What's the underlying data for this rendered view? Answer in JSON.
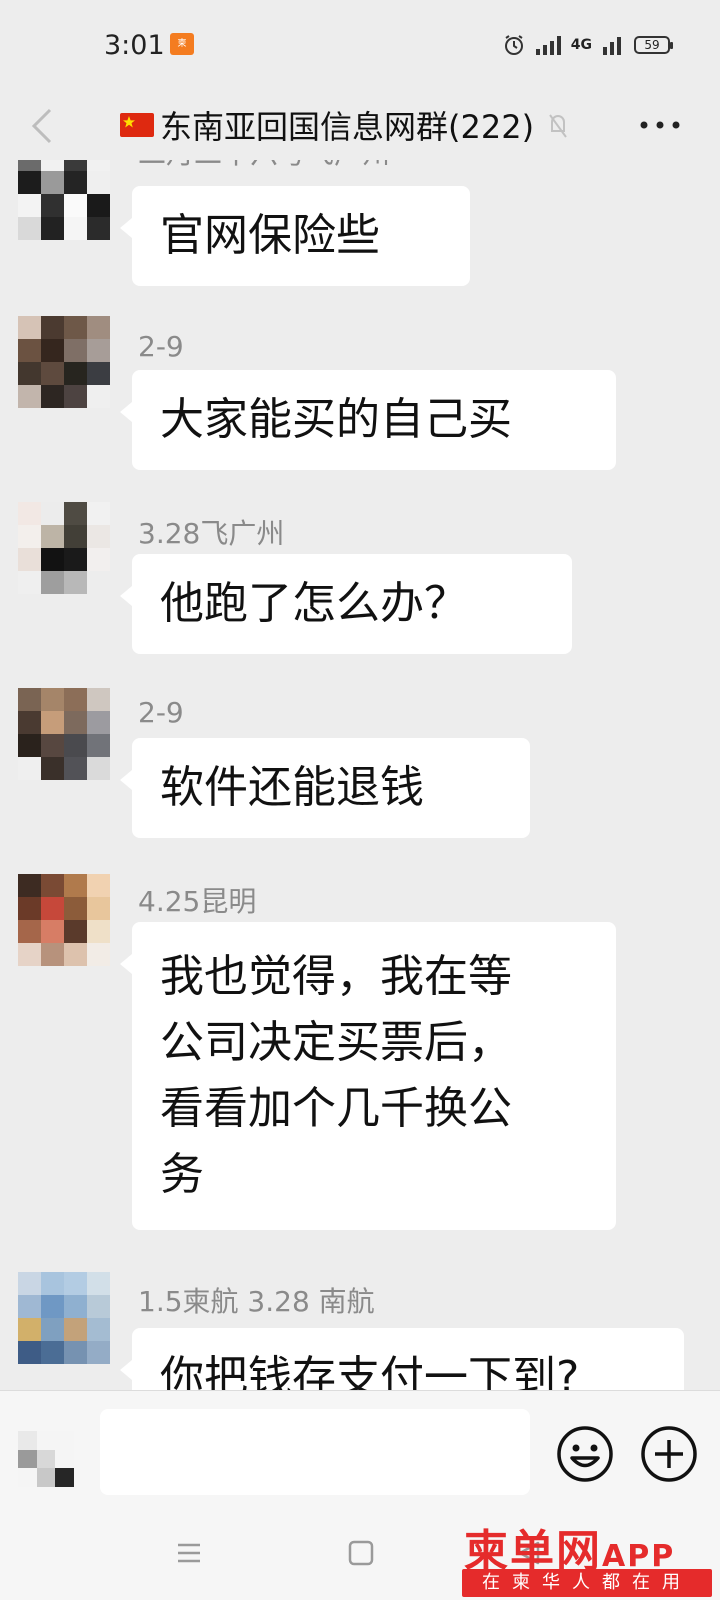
{
  "status_bar": {
    "time": "3:01",
    "network": "4G",
    "battery": "59"
  },
  "header": {
    "title": "东南亚回国信息网群(222)",
    "flag_icon": "china-flag-icon",
    "back_icon": "chevron-left-icon",
    "mute_icon": "mute-icon",
    "more_icon": "more-dots-icon"
  },
  "messages": [
    {
      "sender": "二月二十六号飞广州",
      "text": [
        "官网保险些"
      ],
      "avatar_colors": [
        "#6b6b6b",
        "#f1f1f1",
        "#3a3a3a",
        "#f1f1f1",
        "#1c1c1c",
        "#9a9a9a",
        "#242424",
        "#efefef",
        "#f3f3f3",
        "#303030",
        "#fafafa",
        "#1a1a1a",
        "#d9d9d9",
        "#222222",
        "#f5f5f5",
        "#2b2b2b"
      ]
    },
    {
      "sender": "2-9",
      "text": [
        "大家能买的自己买"
      ],
      "avatar_colors": [
        "#d6c3b6",
        "#4b3a30",
        "#6e5848",
        "#a08d80",
        "#6b5241",
        "#35261e",
        "#7f6f66",
        "#a79d98",
        "#43372e",
        "#5e4a3e",
        "#27251f",
        "#3b3d42",
        "#c2b5ac",
        "#2d2622",
        "#4d4341",
        "#efefef"
      ]
    },
    {
      "sender": "3.28飞广州",
      "text": [
        "他跑了怎么办？"
      ],
      "avatar_colors": [
        "#f2e8e4",
        "#ececec",
        "#4f4b43",
        "#f1f1f1",
        "#f3efec",
        "#bdb4a6",
        "#423f37",
        "#ebe7e4",
        "#e9dfd9",
        "#121212",
        "#1a1a1a",
        "#f2efee",
        "#efefef",
        "#9e9e9e",
        "#b8b8b8",
        "#ededed"
      ]
    },
    {
      "sender": "2-9",
      "text": [
        "软件还能退钱"
      ],
      "avatar_colors": [
        "#7a6453",
        "#a58569",
        "#8c6e58",
        "#cfc7c0",
        "#4a3a31",
        "#c69d7a",
        "#7d6a5d",
        "#9c9ba0",
        "#2a221c",
        "#574740",
        "#4a4a4e",
        "#717379",
        "#efefef",
        "#3a302a",
        "#525257",
        "#dadada"
      ]
    },
    {
      "sender": "4.25昆明",
      "text": [
        "我也觉得，我在等",
        "公司决定买票后，",
        "看看加个几千换公",
        "务"
      ],
      "avatar_colors": [
        "#3d2b22",
        "#7a4a34",
        "#b07a4c",
        "#f1d2b1",
        "#6b3a28",
        "#c6483a",
        "#8c5c3a",
        "#e8c69c",
        "#a5664a",
        "#d77d65",
        "#5a3a2b",
        "#efe0c8",
        "#e6d3c7",
        "#b7927c",
        "#ddc2ad",
        "#f2ece6"
      ]
    },
    {
      "sender": "1.5柬航  3.28  南航",
      "text": [
        "你把钱存支付一下到?"
      ],
      "avatar_colors": [
        "#c9d6e4",
        "#a8c4de",
        "#b3cce3",
        "#d2dfe8",
        "#9fb8d3",
        "#6f98c4",
        "#8fb0d0",
        "#b8cad8",
        "#d2b06a",
        "#7fa0c0",
        "#c3a27a",
        "#a4bcd2",
        "#3e5c86",
        "#4b6d95",
        "#7692b1",
        "#94acc6"
      ]
    }
  ],
  "input_bar": {
    "placeholder": "",
    "emoji_icon": "emoji-icon",
    "plus_icon": "plus-icon"
  },
  "nav_bar": {
    "menu_icon": "menu-icon",
    "home_icon": "home-icon",
    "back_icon": "back-triangle-icon"
  },
  "watermark": {
    "brand": "柬单网",
    "app": "APP",
    "slogan": "在柬华人都在用"
  }
}
